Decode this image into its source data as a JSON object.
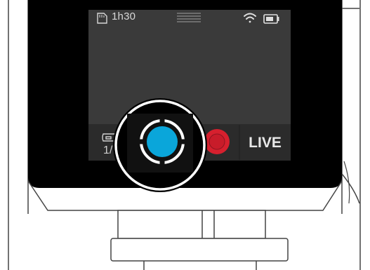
{
  "status_bar": {
    "time_remaining": "1h30",
    "sd_card_icon": "sd-card-icon",
    "menu_icon": "menu-lines-icon",
    "wifi_icon": "wifi-icon",
    "battery_icon": "battery-icon"
  },
  "mode_bar": {
    "storage_count": "1/",
    "live_label": "LIVE"
  },
  "colors": {
    "screen_bg": "#3a3a3a",
    "mode_bar_bg": "#2b2b2b",
    "shutter_blue": "#0aa6da",
    "record_red": "#d6202e",
    "bezel": "#000000"
  }
}
